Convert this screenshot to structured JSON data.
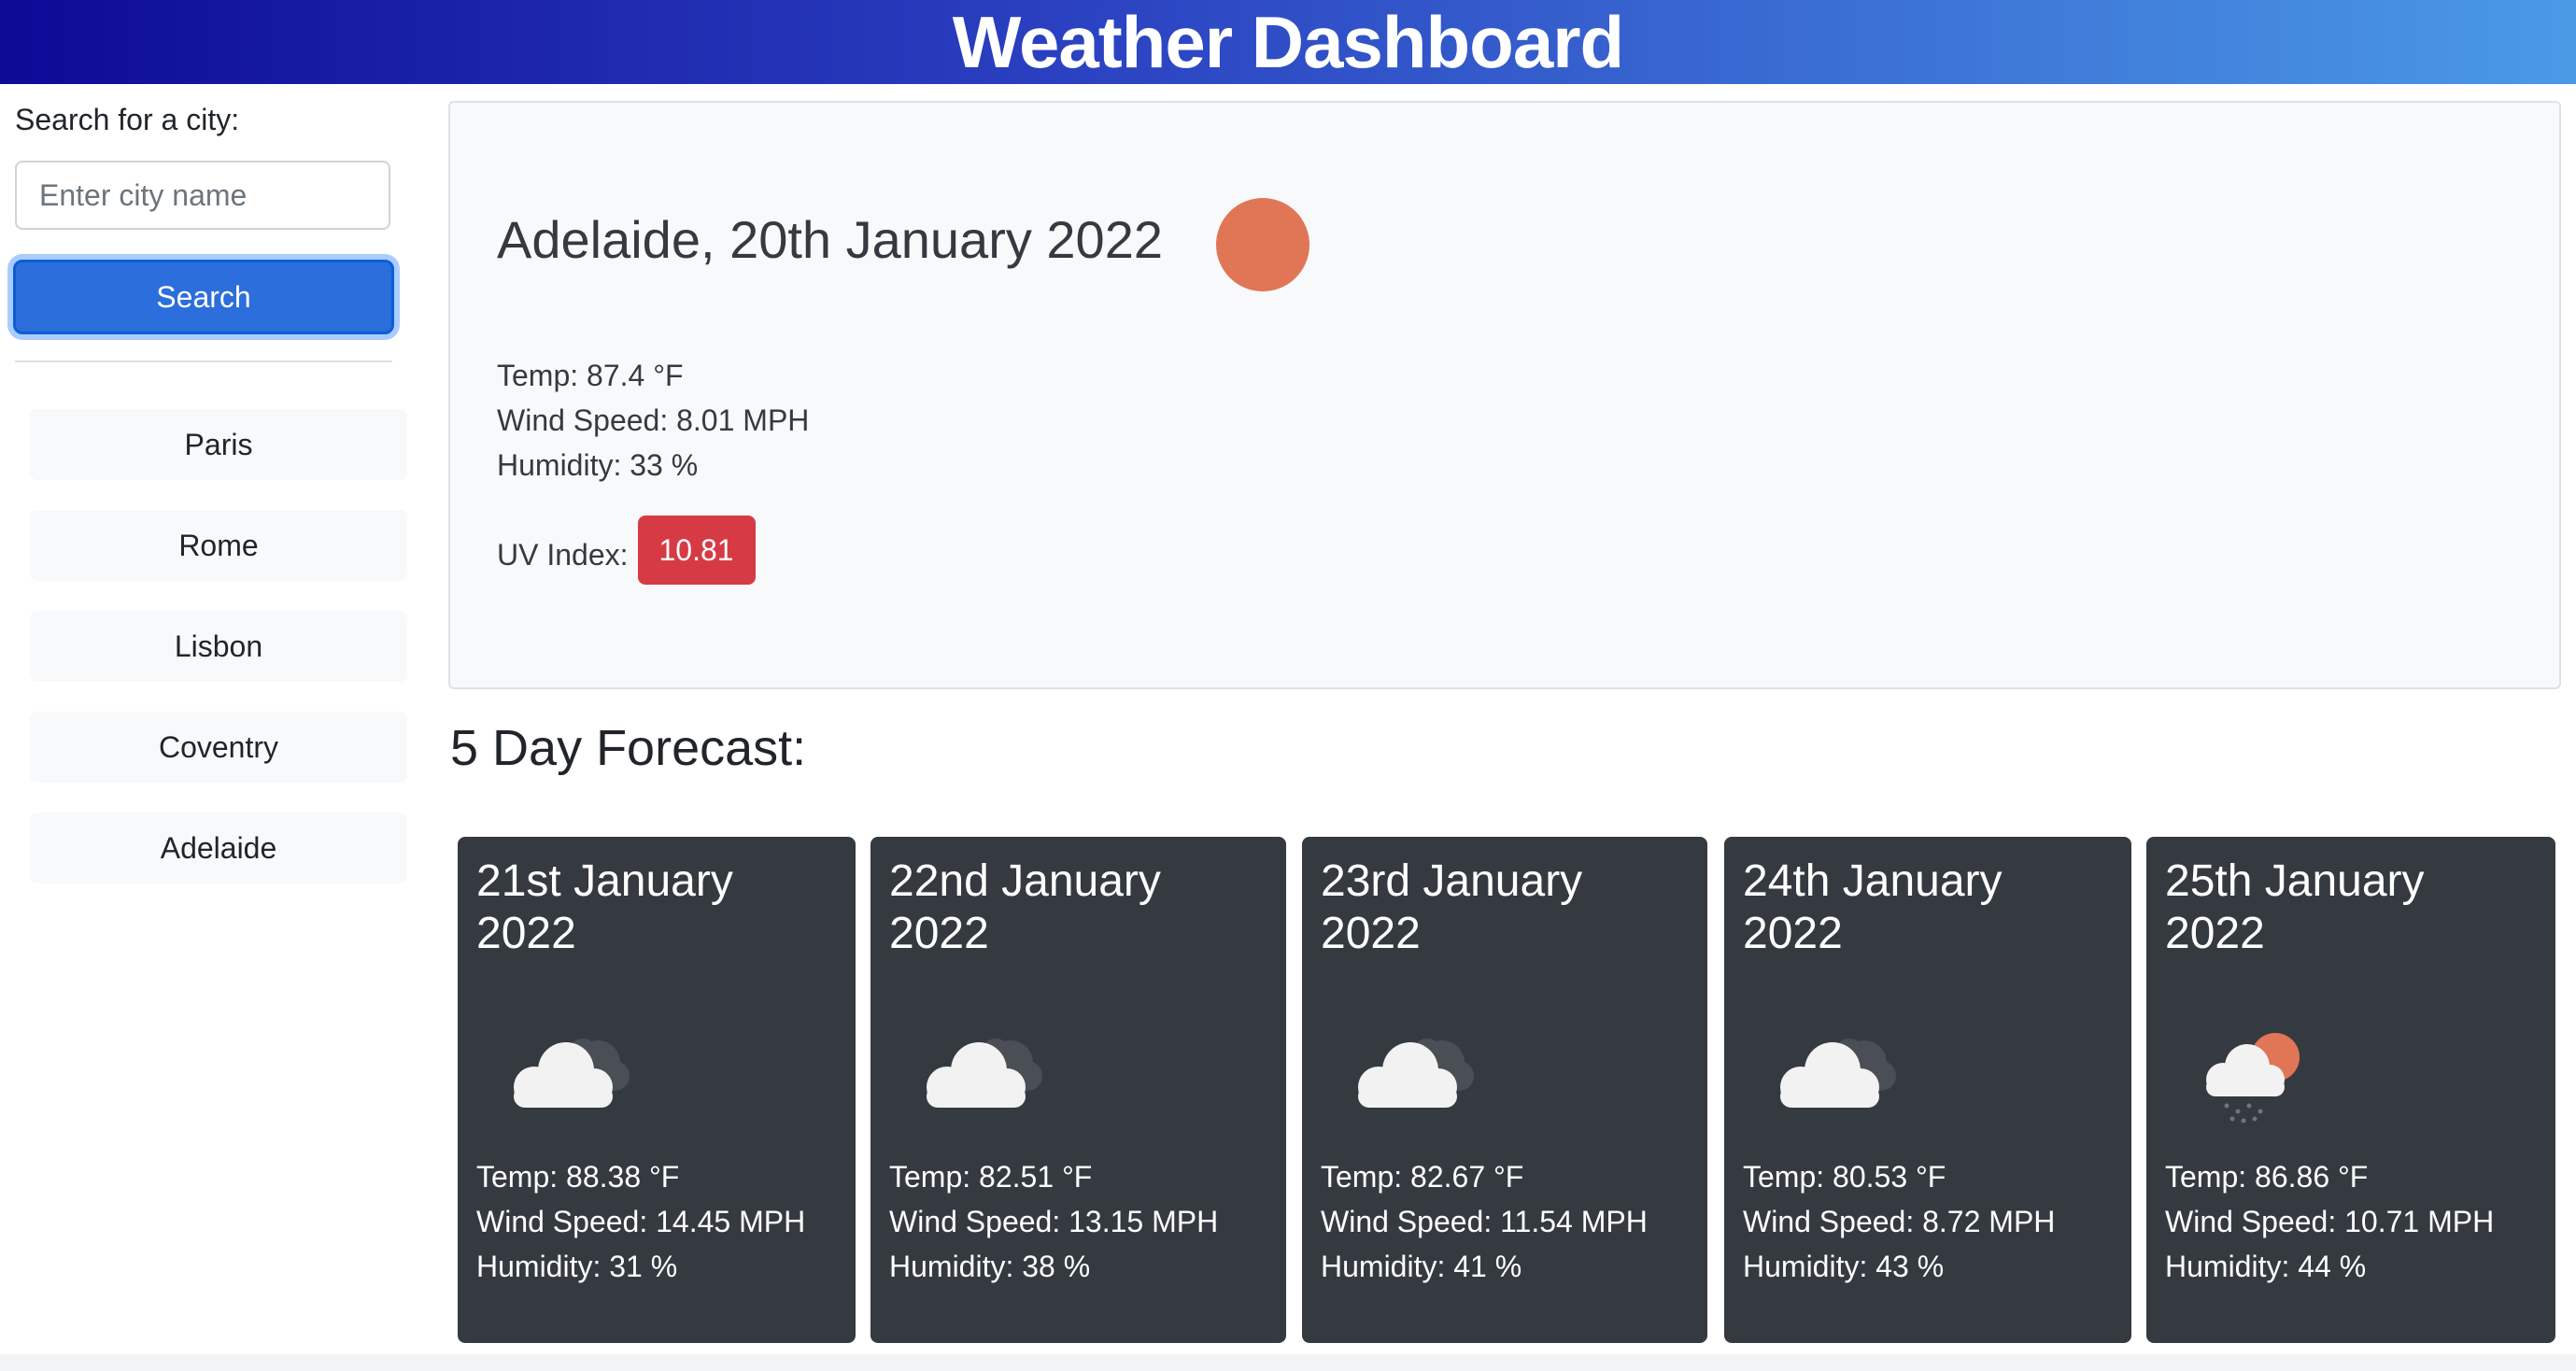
{
  "header": {
    "title": "Weather Dashboard",
    "background_gradient": [
      "#0d0a96",
      "#4a9ae6"
    ]
  },
  "search": {
    "label": "Search for a city:",
    "placeholder": "Enter city name",
    "button_label": "Search",
    "button_color": "#2c6edb"
  },
  "history": [
    "Paris",
    "Rome",
    "Lisbon",
    "Coventry",
    "Adelaide"
  ],
  "current": {
    "heading": "Adelaide, 20th January 2022",
    "icon": "sun-icon",
    "temp": "Temp: 87.4 °F",
    "wind": "Wind Speed: 8.01 MPH",
    "humidity": "Humidity: 33 %",
    "uv_label": "UV Index:",
    "uv_value": "10.81",
    "uv_color": "#d63b45"
  },
  "forecast": {
    "title": "5 Day Forecast:",
    "days": [
      {
        "date": "21st January 2022",
        "icon": "cloudy-icon",
        "temp": "Temp: 88.38 °F",
        "wind": "Wind Speed: 14.45 MPH",
        "humidity": "Humidity: 31 %"
      },
      {
        "date": "22nd January 2022",
        "icon": "cloudy-icon",
        "temp": "Temp: 82.51 °F",
        "wind": "Wind Speed: 13.15 MPH",
        "humidity": "Humidity: 38 %"
      },
      {
        "date": "23rd January 2022",
        "icon": "cloudy-icon",
        "temp": "Temp: 82.67 °F",
        "wind": "Wind Speed: 11.54 MPH",
        "humidity": "Humidity: 41 %"
      },
      {
        "date": "24th January 2022",
        "icon": "cloudy-icon",
        "temp": "Temp: 80.53 °F",
        "wind": "Wind Speed: 8.72 MPH",
        "humidity": "Humidity: 43 %"
      },
      {
        "date": "25th January 2022",
        "icon": "rain-sun-icon",
        "temp": "Temp: 86.86 °F",
        "wind": "Wind Speed: 10.71 MPH",
        "humidity": "Humidity: 44 %"
      }
    ]
  }
}
